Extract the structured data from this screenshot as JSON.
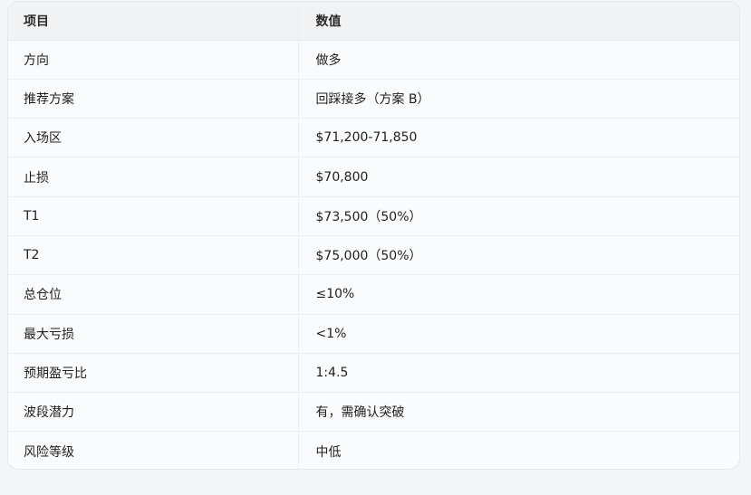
{
  "table": {
    "headers": [
      "项目",
      "数值"
    ],
    "rows": [
      [
        "方向",
        "做多"
      ],
      [
        "推荐方案",
        "回踩接多（方案 B）"
      ],
      [
        "入场区",
        "$71,200-71,850"
      ],
      [
        "止损",
        "$70,800"
      ],
      [
        "T1",
        "$73,500（50%）"
      ],
      [
        "T2",
        "$75,000（50%）"
      ],
      [
        "总仓位",
        "≤10%"
      ],
      [
        "最大亏损",
        "<1%"
      ],
      [
        "预期盈亏比",
        "1:4.5"
      ],
      [
        "波段潜力",
        "有，需确认突破"
      ],
      [
        "风险等级",
        "中低"
      ]
    ]
  }
}
